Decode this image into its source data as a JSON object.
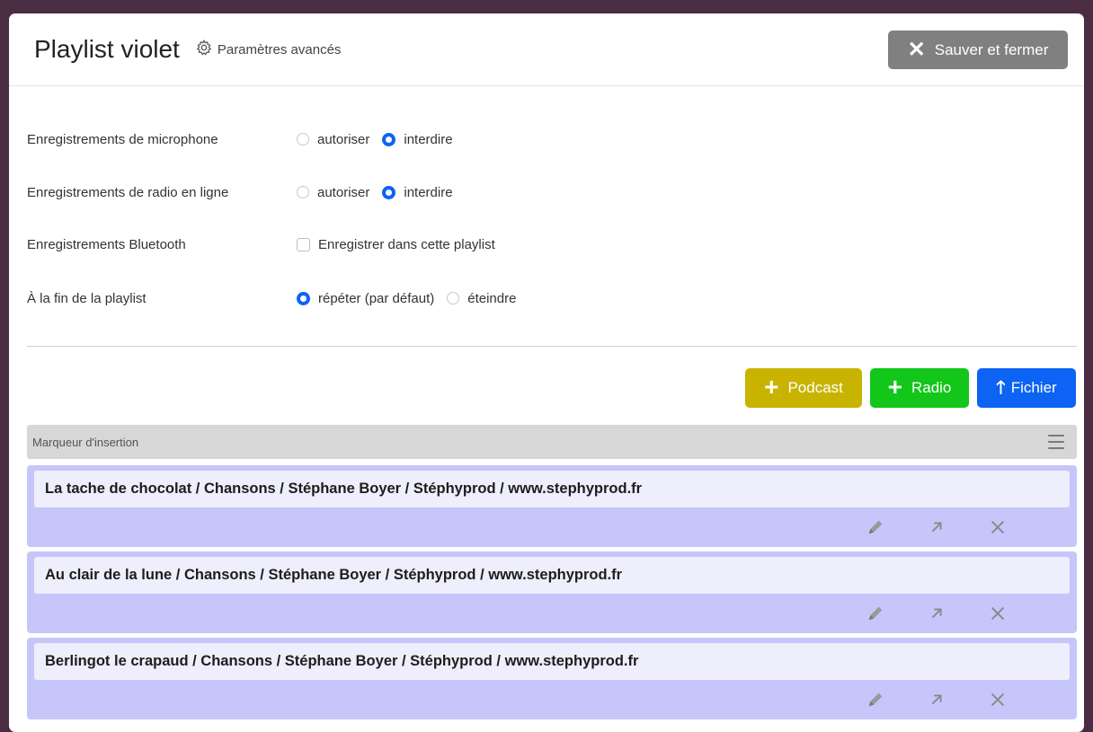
{
  "header": {
    "title": "Playlist violet",
    "advanced_label": "Paramètres avancés",
    "save_close_label": "Sauver et fermer"
  },
  "settings": [
    {
      "label": "Enregistrements de microphone",
      "options": [
        {
          "text": "autoriser",
          "selected": false
        },
        {
          "text": "interdire",
          "selected": true
        }
      ]
    },
    {
      "label": "Enregistrements de radio en ligne",
      "options": [
        {
          "text": "autoriser",
          "selected": false
        },
        {
          "text": "interdire",
          "selected": true
        }
      ]
    },
    {
      "label": "Enregistrements Bluetooth",
      "checkbox": {
        "text": "Enregistrer dans cette playlist",
        "checked": false
      }
    },
    {
      "label": "À la fin de la playlist",
      "options": [
        {
          "text": "répéter (par défaut)",
          "selected": true
        },
        {
          "text": "éteindre",
          "selected": false
        }
      ]
    }
  ],
  "actions": {
    "podcast": "Podcast",
    "radio": "Radio",
    "file": "Fichier",
    "colors": {
      "podcast": "#c8b400",
      "radio": "#12c61a",
      "file": "#0d63f3"
    }
  },
  "insertion_marker": "Marqueur d'insertion",
  "tracks": [
    "La tache de chocolat / Chansons / Stéphane Boyer / Stéphyprod / www.stephyprod.fr",
    "Au clair de la lune / Chansons / Stéphane Boyer / Stéphyprod / www.stephyprod.fr",
    "Berlingot le crapaud / Chansons / Stéphane Boyer / Stéphyprod / www.stephyprod.fr"
  ],
  "track_tools": [
    "pencil-icon",
    "move-icon",
    "delete-icon",
    "drag-icon"
  ]
}
